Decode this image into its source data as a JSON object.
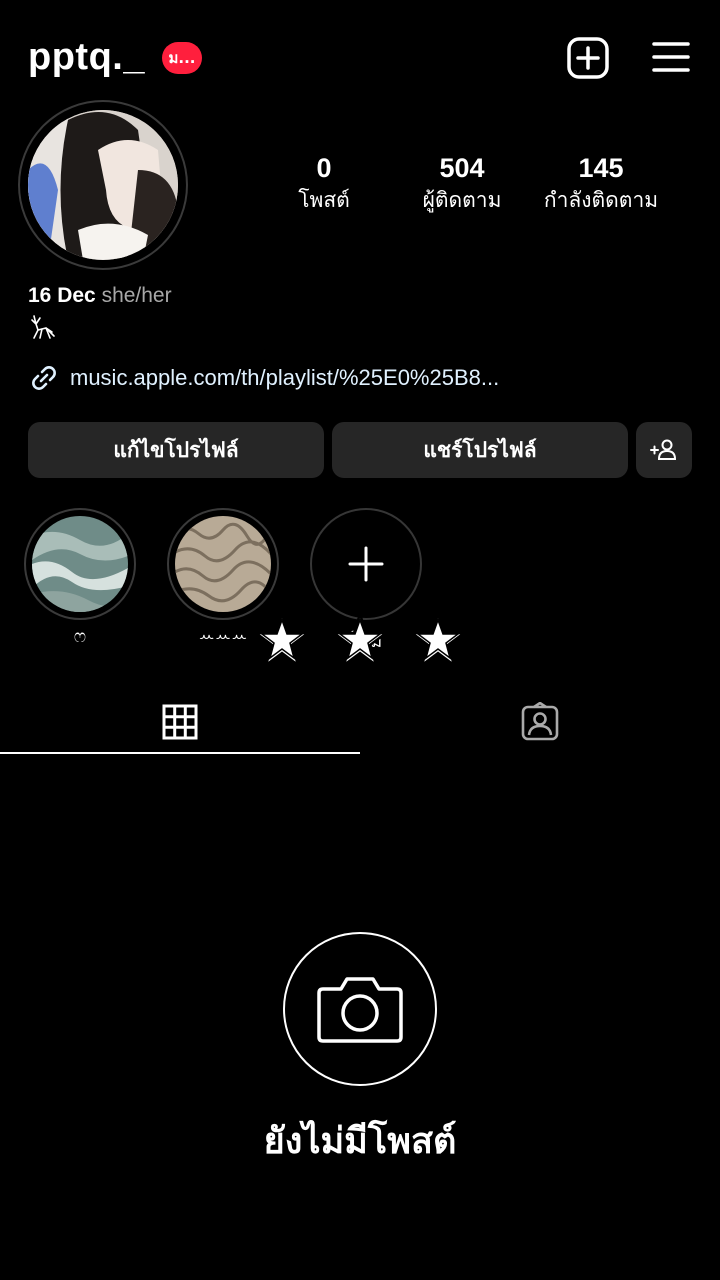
{
  "header": {
    "username": "pptq._",
    "notification_badge": "ม...",
    "badge_color": "#ff1f3d",
    "add_icon": "plus-square-icon",
    "menu_icon": "hamburger-menu-icon"
  },
  "stats": [
    {
      "value": "0",
      "label": "โพสต์"
    },
    {
      "value": "504",
      "label": "ผู้ติดตาม"
    },
    {
      "value": "145",
      "label": "กำลังติดตาม"
    }
  ],
  "bio": {
    "name": "16 Dec",
    "pronouns": "she/her",
    "glyph_icon": "deer-doodle-icon",
    "link_icon": "link-icon",
    "link": "music.apple.com/th/playlist/%25E0%25B8..."
  },
  "buttons": {
    "edit_profile": "แก้ไขโปรไฟล์",
    "share_profile": "แชร์โปรไฟล์",
    "discover_icon": "add-person-icon"
  },
  "highlights": [
    {
      "label": "ෆ"
    },
    {
      "label": "ꕀꕀꕀ"
    },
    {
      "label": "ใหม่",
      "icon": "plus-icon"
    }
  ],
  "overlay_stars": [
    "star-icon",
    "star-icon",
    "star-icon"
  ],
  "tabs": [
    {
      "icon": "grid-icon",
      "active": true
    },
    {
      "icon": "tagged-person-icon",
      "active": false
    }
  ],
  "empty_state": {
    "icon": "camera-icon",
    "title": "ยังไม่มีโพสต์"
  }
}
